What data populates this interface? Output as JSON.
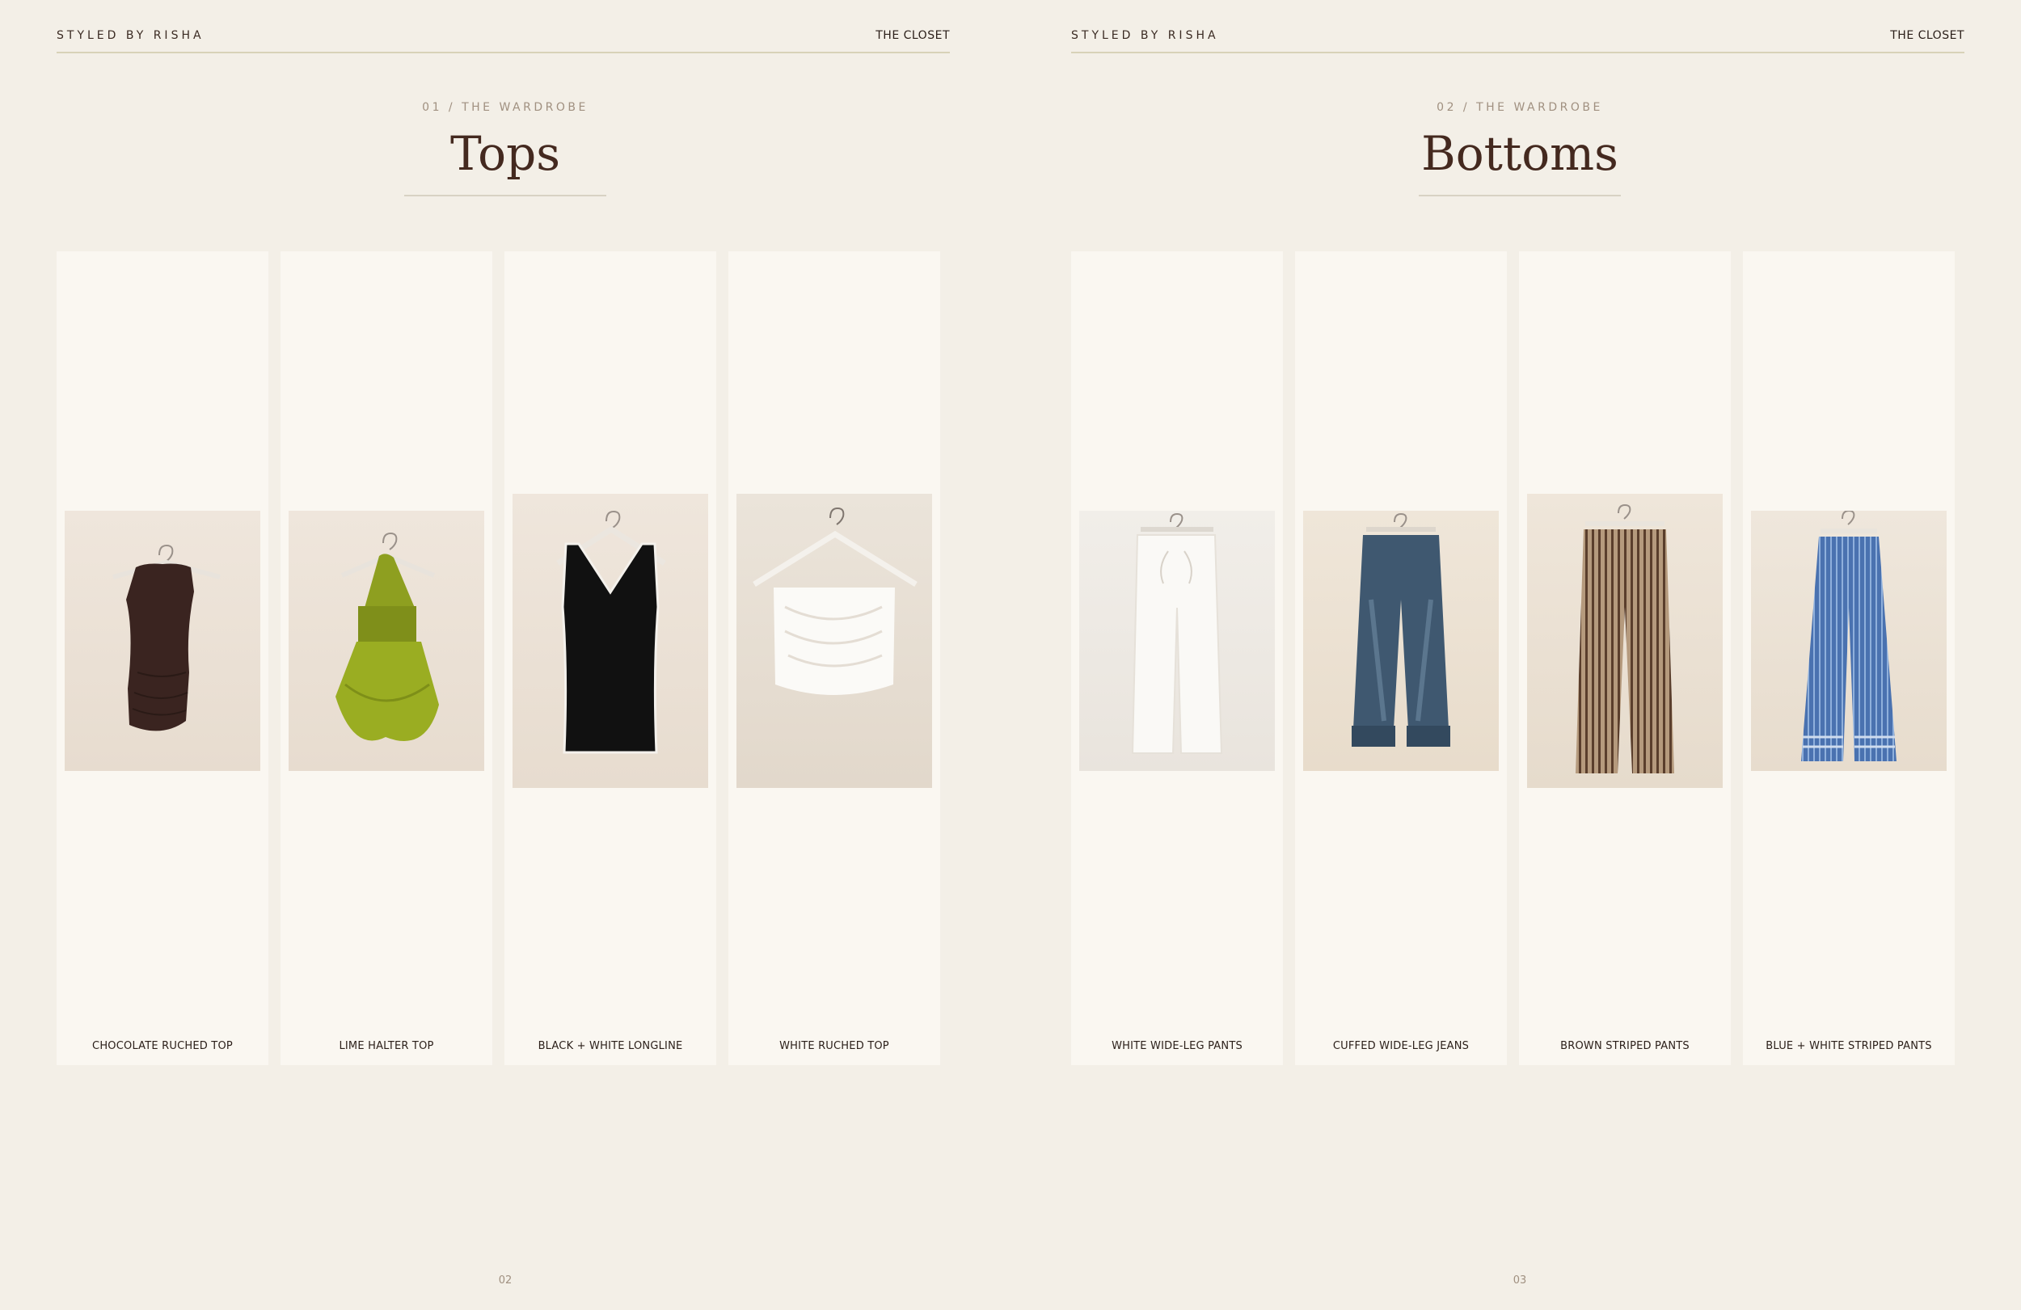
{
  "pages": [
    {
      "brand": "STYLED BY RISHA",
      "header_right": "THE CLOSET",
      "eyebrow": "01 / THE WARDROBE",
      "title": "Tops",
      "folio": "02",
      "items": [
        {
          "label": "CHOCOLATE RUCHED TOP",
          "icon": "brown-sleeveless-top-icon"
        },
        {
          "label": "LIME HALTER TOP",
          "icon": "lime-halter-top-icon"
        },
        {
          "label": "BLACK + WHITE LONGLINE",
          "icon": "black-tank-top-icon"
        },
        {
          "label": "WHITE RUCHED TOP",
          "icon": "white-ruched-top-icon"
        }
      ]
    },
    {
      "brand": "STYLED BY RISHA",
      "header_right": "THE CLOSET",
      "eyebrow": "02 / THE WARDROBE",
      "title": "Bottoms",
      "folio": "03",
      "items": [
        {
          "label": "WHITE WIDE-LEG PANTS",
          "icon": "white-pants-icon"
        },
        {
          "label": "CUFFED WIDE-LEG JEANS",
          "icon": "denim-jeans-icon"
        },
        {
          "label": "BROWN STRIPED PANTS",
          "icon": "brown-striped-pants-icon"
        },
        {
          "label": "BLUE + WHITE STRIPED PANTS",
          "icon": "blue-striped-pants-icon"
        }
      ]
    }
  ],
  "colors": {
    "background": "#f3efe7",
    "card": "#faf7f1",
    "title": "#44291f",
    "rule": "#d8d2b8"
  }
}
